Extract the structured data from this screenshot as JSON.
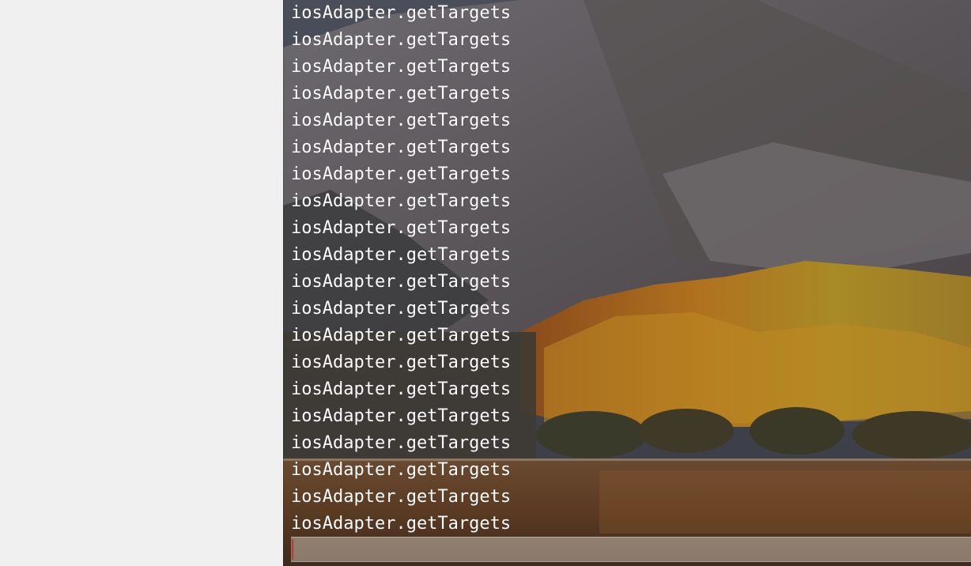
{
  "terminal": {
    "lines": [
      "iosAdapter.getTargets",
      "iosAdapter.getTargets",
      "iosAdapter.getTargets",
      "iosAdapter.getTargets",
      "iosAdapter.getTargets",
      "iosAdapter.getTargets",
      "iosAdapter.getTargets",
      "iosAdapter.getTargets",
      "iosAdapter.getTargets",
      "iosAdapter.getTargets",
      "iosAdapter.getTargets",
      "iosAdapter.getTargets",
      "iosAdapter.getTargets",
      "iosAdapter.getTargets",
      "iosAdapter.getTargets",
      "iosAdapter.getTargets",
      "iosAdapter.getTargets",
      "iosAdapter.getTargets",
      "iosAdapter.getTargets",
      "iosAdapter.getTargets"
    ],
    "input_value": "",
    "text_color": "#ffffff",
    "cursor_color": "#c0392b"
  },
  "wallpaper": {
    "icon": "mountain-lake-wallpaper"
  }
}
